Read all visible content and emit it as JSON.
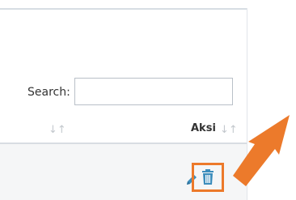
{
  "search": {
    "label": "Search:",
    "value": "",
    "placeholder": ""
  },
  "table": {
    "columns": [
      {
        "label": "",
        "sort_icon": "sort-icon"
      },
      {
        "label": "Aksi",
        "sort_icon": "sort-icon"
      }
    ],
    "row_actions": [
      "edit-icon",
      "trash-icon"
    ]
  },
  "annotation": {
    "arrow_color": "#ec7a2b",
    "highlight_color": "#ec7a2b"
  },
  "colors": {
    "icon_blue": "#3c8dbc"
  }
}
